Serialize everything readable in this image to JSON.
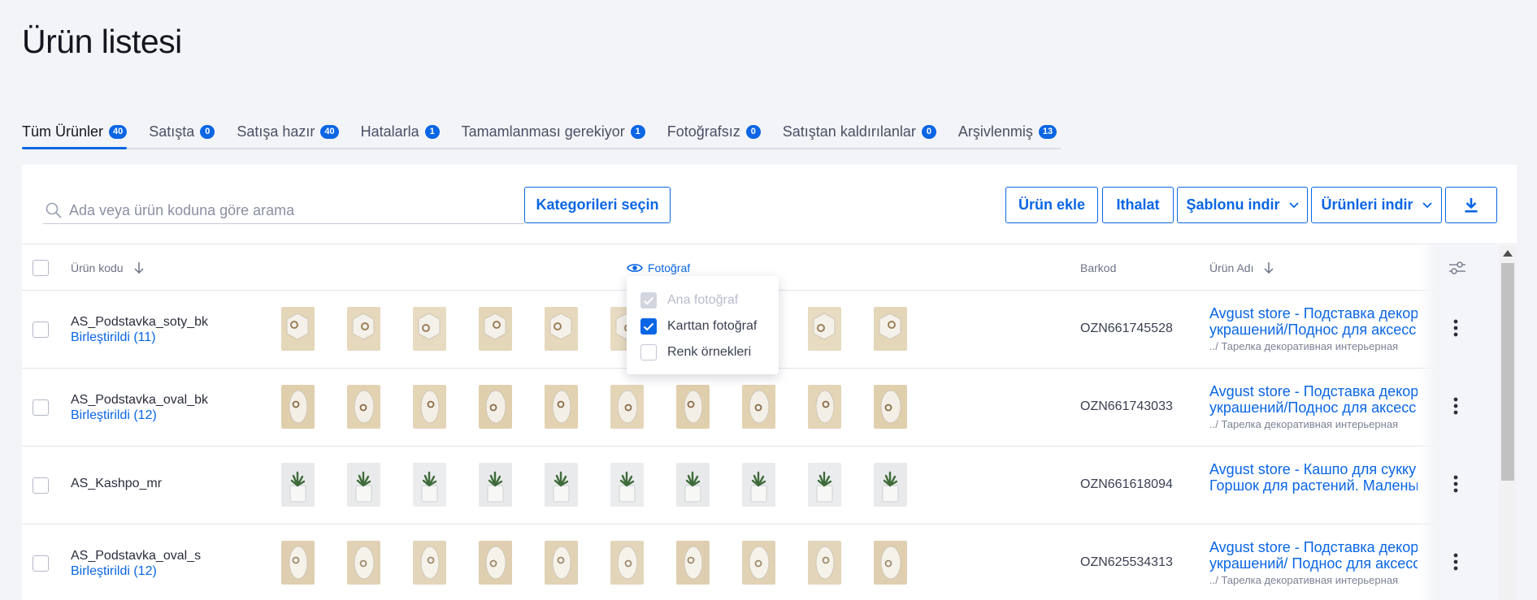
{
  "page": {
    "title": "Ürün listesi"
  },
  "tabs": [
    {
      "label": "Tüm Ürünler",
      "count": "40",
      "active": true
    },
    {
      "label": "Satışta",
      "count": "0"
    },
    {
      "label": "Satışa hazır",
      "count": "40"
    },
    {
      "label": "Hatalarla",
      "count": "1"
    },
    {
      "label": "Tamamlanması gerekiyor",
      "count": "1"
    },
    {
      "label": "Fotoğrafsız",
      "count": "0"
    },
    {
      "label": "Satıştan kaldırılanlar",
      "count": "0"
    },
    {
      "label": "Arşivlenmiş",
      "count": "13"
    }
  ],
  "toolbar": {
    "search_placeholder": "Ada veya ürün koduna göre arama",
    "categories_button": "Kategorileri seçin",
    "add_product_button": "Ürün ekle",
    "import_button": "Ithalat",
    "download_template_button": "Şablonu indir",
    "download_products_button": "Ürünleri indir",
    "download_icon": "download-icon"
  },
  "columns": {
    "code": "Ürün kodu",
    "photo": "Fotoğraf",
    "barcode": "Barkod",
    "name": "Ürün Adı"
  },
  "photo_menu": {
    "options": [
      {
        "label": "Ana fotoğraf",
        "state": "disabled-checked"
      },
      {
        "label": "Karttan fotoğraf",
        "state": "checked"
      },
      {
        "label": "Renk örnekleri",
        "state": "unchecked"
      }
    ]
  },
  "rows": [
    {
      "code": "AS_Podstavka_soty_bk",
      "merged": "Birleştirildi (11)",
      "barcode": "OZN661745528",
      "name_line1": "Avgust store - Подставка декор",
      "name_line2": "украшений/Поднос для аксесс",
      "category": "../ Тарелка декоративная интерьерная",
      "photo_theme": "hex"
    },
    {
      "code": "AS_Podstavka_oval_bk",
      "merged": "Birleştirildi (12)",
      "barcode": "OZN661743033",
      "name_line1": "Avgust store - Подставка декор",
      "name_line2": "украшений/Поднос для аксесс",
      "category": "../ Тарелка декоративная интерьерная",
      "photo_theme": "oval"
    },
    {
      "code": "AS_Kashpo_mr",
      "merged": "",
      "barcode": "OZN661618094",
      "name_line1": "Avgust store - Кашпо для сукку",
      "name_line2": "Горшок для растений. Маленьк",
      "category": "",
      "photo_theme": "plant"
    },
    {
      "code": "AS_Podstavka_oval_s",
      "merged": "Birleştirildi (12)",
      "barcode": "OZN625534313",
      "name_line1": "Avgust store - Подставка декор",
      "name_line2": "украшений/ Поднос для аксесс",
      "category": "../ Тарелка декоративная интерьерная",
      "photo_theme": "oval-light"
    }
  ],
  "colors": {
    "accent": "#0a66e4",
    "background": "#f3f4f8",
    "sand": "#e2d3b4"
  }
}
